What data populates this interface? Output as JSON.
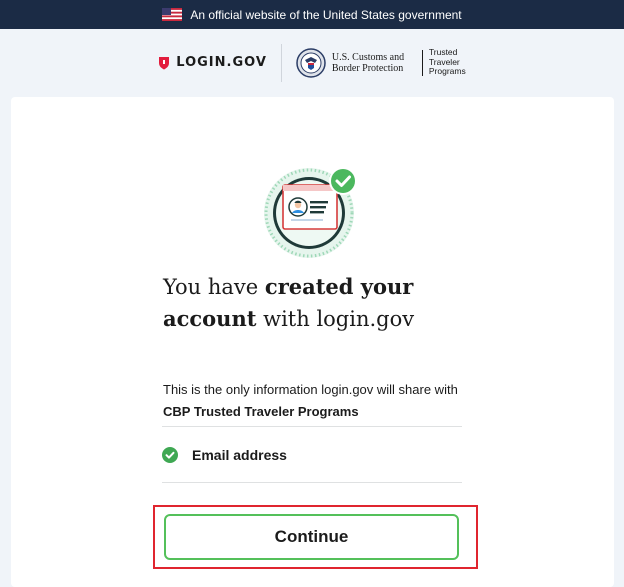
{
  "gov_banner": {
    "text": "An official website of the United States government"
  },
  "header": {
    "logo_text": "LOGIN.GOV",
    "agency_line1": "U.S. Customs and",
    "agency_line2": "Border Protection",
    "program_line1": "Trusted",
    "program_line2": "Traveler",
    "program_line3": "Programs"
  },
  "main": {
    "heading_part1": "You have ",
    "heading_bold": "created your account",
    "heading_part2": " with login.gov",
    "intro_text": "This is the only information login.gov will share with ",
    "intro_bold": "CBP Trusted Traveler Programs",
    "attributes": [
      {
        "label": "Email address"
      }
    ],
    "continue_label": "Continue"
  },
  "colors": {
    "banner_bg": "#1b2b45",
    "page_bg": "#f0f4f9",
    "success_green": "#54c05a",
    "highlight_red": "#e0252f",
    "brand_red": "#e21c3d"
  },
  "icons": [
    "us-flag-icon",
    "login-gov-shield-icon",
    "cbp-seal-icon",
    "account-created-illustration",
    "check-circle-icon"
  ]
}
